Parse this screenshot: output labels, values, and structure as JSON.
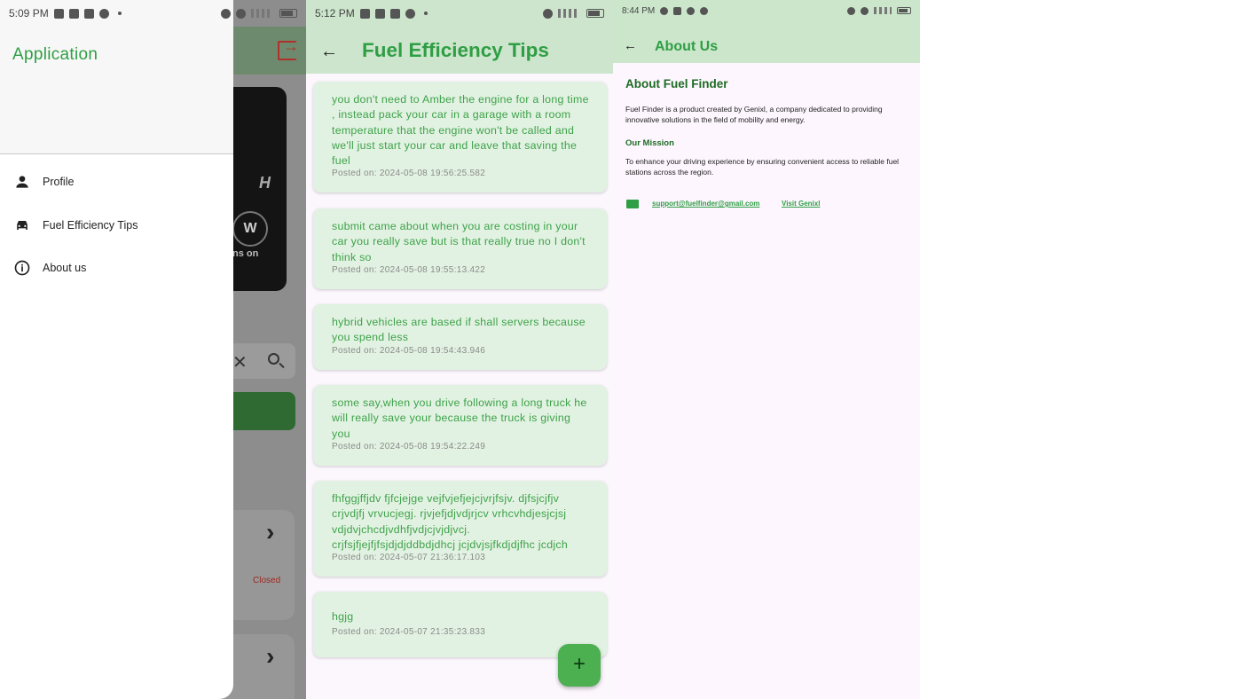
{
  "screen1": {
    "status": {
      "time": "5:09 PM"
    },
    "drawer": {
      "title": "Application",
      "items": [
        {
          "label": "Profile",
          "icon": "person-icon"
        },
        {
          "label": "Fuel Efficiency Tips",
          "icon": "car-icon"
        },
        {
          "label": "About us",
          "icon": "info-icon"
        }
      ]
    },
    "background": {
      "dash_h": "H",
      "dash_w": "W",
      "dash_on": "ns on",
      "closed_label": "Closed"
    }
  },
  "screen2": {
    "status": {
      "time": "5:12 PM"
    },
    "title": "Fuel Efficiency Tips",
    "tips": [
      {
        "text": "you don't need to Amber the engine for a long time , instead pack your car in a garage with a room temperature that the engine won't be called and we'll just start your car and leave that saving the fuel",
        "date": "Posted on: 2024-05-08 19:56:25.582"
      },
      {
        "text": "submit came about when you are costing in your car you really save but is that really true no I don't think so",
        "date": "Posted on: 2024-05-08 19:55:13.422"
      },
      {
        "text": "hybrid vehicles are based if shall servers because you spend less",
        "date": "Posted on: 2024-05-08 19:54:43.946"
      },
      {
        "text": "some say,when you drive following a long truck he will really save your because the truck is giving you",
        "date": "Posted on: 2024-05-08 19:54:22.249"
      },
      {
        "text": "fhfggjffjdv fjfcjejge vejfvjefjejcjvrjfsjv. djfsjcjfjv crjvdjfj vrvucjegj. rjvjefjdjvdjrjcv vrhcvhdjesjcjsj vdjdvjchcdjvdhfjvdjcjvjdjvcj. crjfsjfjejfjfsjdjdjddbdjdhcj jcjdvjsjfkdjdjfhc jcdjch",
        "date": "Posted on: 2024-05-07 21:36:17.103"
      },
      {
        "text": "hgjg",
        "date": "Posted on: 2024-05-07 21:35:23.833"
      }
    ],
    "fab_label": "+"
  },
  "screen3": {
    "status": {
      "time": "8:44 PM"
    },
    "title": "About Us",
    "heading": "About Fuel Finder",
    "intro": "Fuel Finder is a product created by Genixl, a company dedicated to providing innovative solutions in the field of mobility and energy.",
    "mission_heading": "Our Mission",
    "mission_text": "To enhance your driving experience by ensuring convenient access to reliable fuel stations across the region.",
    "email": "support@fuelfinder@gmail.com",
    "visit_link": "Visit Genixl"
  },
  "colors": {
    "accent": "#2f9e44",
    "appbar": "#cce5cc",
    "card": "#e2f2e2",
    "fab": "#4caf50",
    "logout": "#b0302a"
  }
}
